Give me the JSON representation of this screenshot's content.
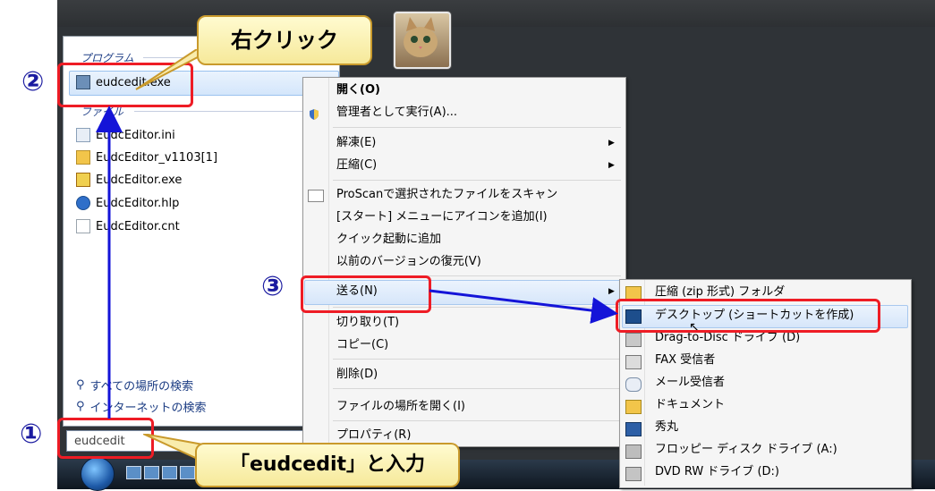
{
  "start_menu": {
    "section_programs": "プログラム",
    "section_files": "ファイル",
    "program_item": "eudcedit.exe",
    "files": [
      "EudcEditor.ini",
      "EudcEditor_v1103[1]",
      "EudcEditor.exe",
      "EudcEditor.hlp",
      "EudcEditor.cnt"
    ],
    "search_everywhere": "すべての場所の検索",
    "search_internet": "インターネットの検索",
    "search_value": "eudcedit"
  },
  "context_menu": {
    "open": "開く(O)",
    "run_as_admin": "管理者として実行(A)...",
    "extract": "解凍(E)",
    "compress": "圧縮(C)",
    "proscan": "ProScanで選択されたファイルをスキャン",
    "add_start_menu": "[スタート] メニューにアイコンを追加(I)",
    "add_quick_launch": "クイック起動に追加",
    "restore_versions": "以前のバージョンの復元(V)",
    "send_to": "送る(N)",
    "cut": "切り取り(T)",
    "copy": "コピー(C)",
    "delete": "削除(D)",
    "open_location": "ファイルの場所を開く(I)",
    "properties": "プロパティ(R)"
  },
  "send_to_menu": {
    "items": [
      "圧縮 (zip 形式) フォルダ",
      "デスクトップ (ショートカットを作成)",
      "Drag-to-Disc ドライブ (D)",
      "FAX 受信者",
      "メール受信者",
      "ドキュメント",
      "秀丸",
      "フロッピー ディスク ドライブ (A:)",
      "DVD RW ドライブ (D:)"
    ]
  },
  "annotations": {
    "right_click_callout": "右クリック",
    "input_callout": "「eudcedit」と入力",
    "step1": "①",
    "step2": "②",
    "step3": "③",
    "red": "#ee1c25",
    "arrow_blue": "#1414d8"
  }
}
